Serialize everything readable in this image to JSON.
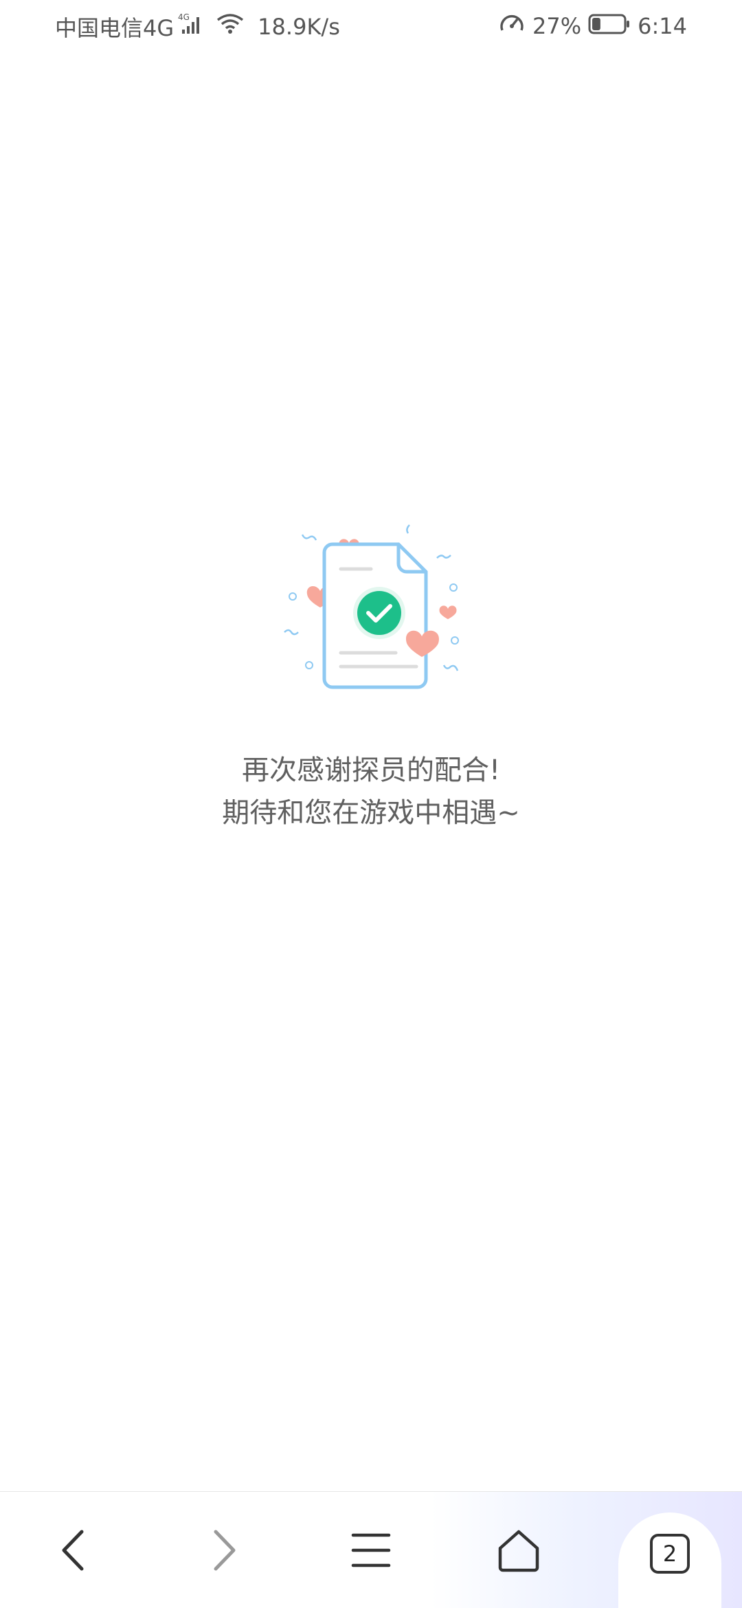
{
  "status_bar": {
    "carrier": "中国电信4G",
    "network_badge": "4G",
    "speed": "18.9K/s",
    "battery_percent": "27%",
    "battery_level": 0.27,
    "time": "6:14",
    "icons": [
      "signal-icon",
      "wifi-icon",
      "speedometer-icon",
      "battery-icon"
    ]
  },
  "main": {
    "message_line1": "再次感谢探员的配合!",
    "message_line2": "期待和您在游戏中相遇~"
  },
  "bottom_nav": {
    "tabs_count": "2",
    "icons": [
      "back-icon",
      "forward-icon",
      "menu-icon",
      "home-icon",
      "tabs-icon"
    ]
  },
  "colors": {
    "accent_green": "#1dbf8a",
    "doc_outline": "#8ec9f2",
    "heart": "#f7a89b",
    "text": "#5f5f5f"
  }
}
